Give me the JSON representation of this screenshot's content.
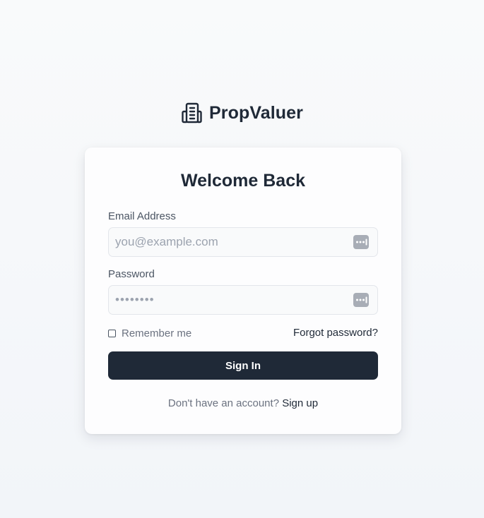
{
  "brand": {
    "name": "PropValuer",
    "icon": "building-icon"
  },
  "login_form": {
    "title": "Welcome Back",
    "email": {
      "label": "Email Address",
      "placeholder": "you@example.com",
      "value": "",
      "icon": "password-manager-key-icon"
    },
    "password": {
      "label": "Password",
      "placeholder": "••••••••",
      "value": "",
      "icon": "password-manager-key-icon"
    },
    "remember_me": {
      "label": "Remember me",
      "checked": false
    },
    "forgot_password_link": "Forgot password?",
    "submit_label": "Sign In",
    "signup_prompt": "Don't have an account?",
    "signup_link": "Sign up"
  },
  "colors": {
    "primary": "#1f2937",
    "muted_text": "#6b7280",
    "label_text": "#4b5563",
    "input_border": "#e3e6eb",
    "input_background": "#f9fafb",
    "card_background": "#fdfdfe",
    "page_background": "#f5f7fa"
  }
}
